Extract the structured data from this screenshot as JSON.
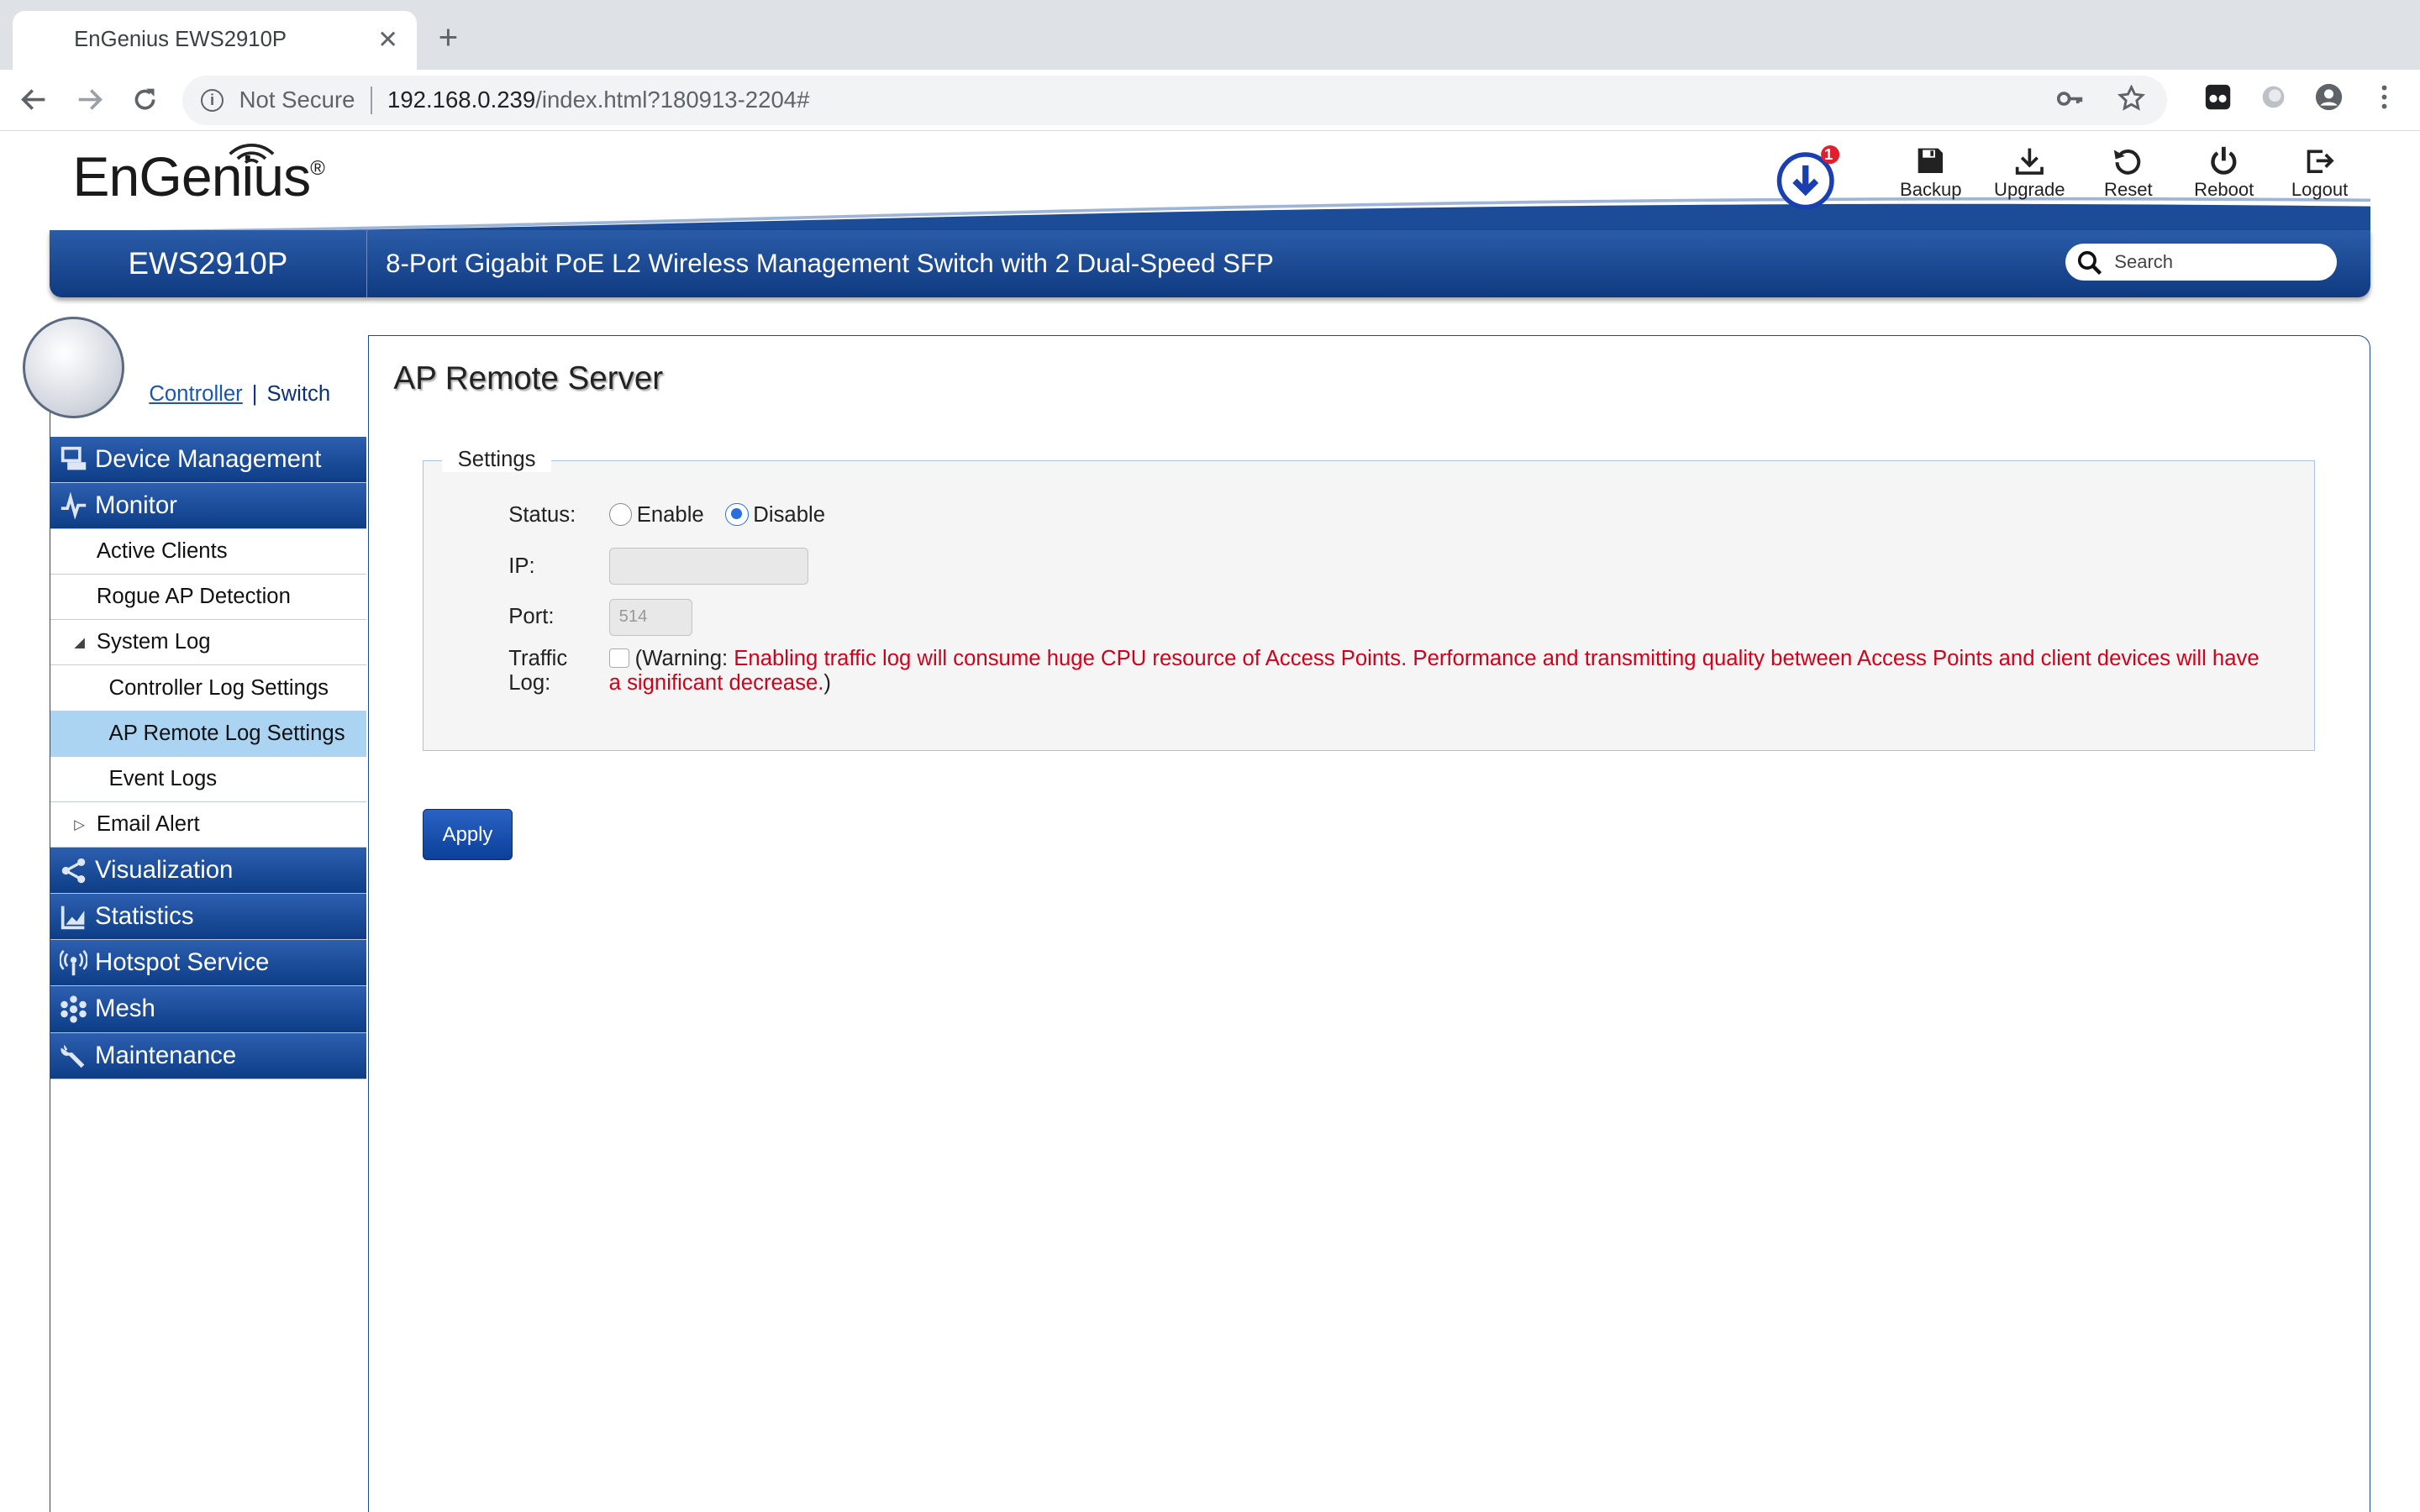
{
  "browser": {
    "tab_title": "EnGenius EWS2910P",
    "tab_close": "✕",
    "new_tab": "+",
    "not_secure": "Not Secure",
    "url_host": "192.168.0.239",
    "url_path": "/index.html?180913-2204#"
  },
  "header": {
    "logo": "EnGenius",
    "logo_mark": "®",
    "notification_count": "1",
    "actions": {
      "backup": "Backup",
      "upgrade": "Upgrade",
      "reset": "Reset",
      "reboot": "Reboot",
      "logout": "Logout"
    },
    "model": "EWS2910P",
    "product_desc": "8-Port Gigabit PoE L2 Wireless Management Switch with 2 Dual-Speed SFP",
    "search_placeholder": "Search"
  },
  "sidebar": {
    "view_controller": "Controller",
    "view_sep": "|",
    "view_switch": "Switch",
    "device_management": "Device Management",
    "monitor": "Monitor",
    "active_clients": "Active Clients",
    "rogue_ap": "Rogue AP Detection",
    "system_log": "System Log",
    "system_log_caret": "◢",
    "controller_log": "Controller Log Settings",
    "ap_remote_log": "AP Remote Log Settings",
    "event_logs": "Event Logs",
    "email_alert": "Email Alert",
    "email_alert_caret": "▷",
    "visualization": "Visualization",
    "statistics": "Statistics",
    "hotspot": "Hotspot Service",
    "mesh": "Mesh",
    "maintenance": "Maintenance"
  },
  "main": {
    "title": "AP Remote Server",
    "legend": "Settings",
    "status_label": "Status:",
    "enable": "Enable",
    "disable": "Disable",
    "ip_label": "IP:",
    "ip_value": "",
    "port_label": "Port:",
    "port_value": "514",
    "traffic_label_1": "Traffic",
    "traffic_label_2": "Log:",
    "warning_prefix": "(Warning: ",
    "warning_red": "Enabling traffic log will consume huge CPU resource of Access Points. Performance and transmitting quality between Access Points and client devices will have a significant decrease.",
    "warning_suffix": ")",
    "apply": "Apply"
  }
}
